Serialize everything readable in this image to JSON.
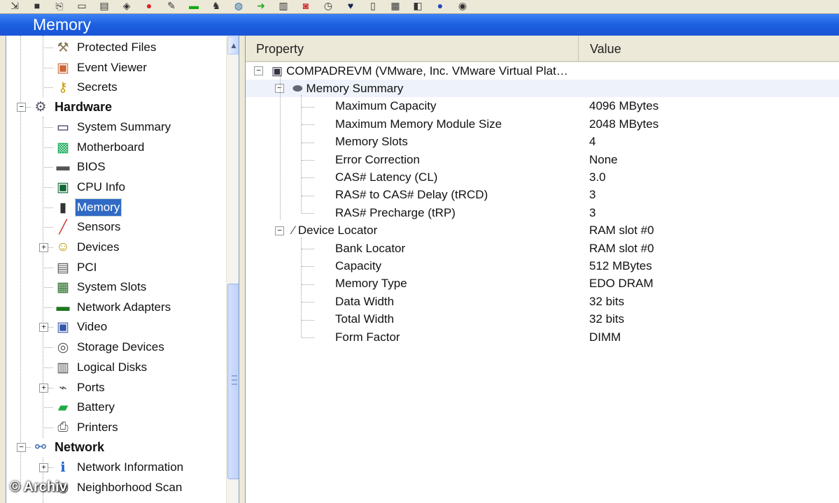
{
  "window": {
    "title": "Memory"
  },
  "toolbar": {
    "icons": [
      "export-icon",
      "save-icon",
      "copy-icon",
      "clipboard-icon",
      "print-icon",
      "scan-icon",
      "close-icon",
      "chat-icon",
      "green-icon",
      "wolf-icon",
      "globe-icon",
      "arrow-icon",
      "report-icon",
      "camera-icon",
      "clock-icon",
      "shield-icon",
      "books-icon",
      "chip-icon",
      "window-icon",
      "info-icon",
      "eye-icon"
    ]
  },
  "tree": {
    "items": [
      {
        "label": "Protected Files",
        "icon": "tools-icon"
      },
      {
        "label": "Event Viewer",
        "icon": "event-icon"
      },
      {
        "label": "Secrets",
        "icon": "key-icon"
      },
      {
        "label": "Hardware",
        "icon": "hardware-icon"
      },
      {
        "label": "System Summary",
        "icon": "monitor-icon"
      },
      {
        "label": "Motherboard",
        "icon": "motherboard-icon"
      },
      {
        "label": "BIOS",
        "icon": "bios-chip-icon"
      },
      {
        "label": "CPU Info",
        "icon": "cpu-icon"
      },
      {
        "label": "Memory",
        "icon": "memory-icon"
      },
      {
        "label": "Sensors",
        "icon": "thermometer-icon"
      },
      {
        "label": "Devices",
        "icon": "devices-icon"
      },
      {
        "label": "PCI",
        "icon": "pci-icon"
      },
      {
        "label": "System Slots",
        "icon": "slots-icon"
      },
      {
        "label": "Network Adapters",
        "icon": "nic-icon"
      },
      {
        "label": "Video",
        "icon": "video-icon"
      },
      {
        "label": "Storage Devices",
        "icon": "storage-icon"
      },
      {
        "label": "Logical Disks",
        "icon": "disk-icon"
      },
      {
        "label": "Ports",
        "icon": "ports-icon"
      },
      {
        "label": "Battery",
        "icon": "battery-icon"
      },
      {
        "label": "Printers",
        "icon": "printer-icon"
      },
      {
        "label": "Network",
        "icon": "network-icon"
      },
      {
        "label": "Network Information",
        "icon": "info-icon"
      },
      {
        "label": "Neighborhood Scan",
        "icon": "scan-icon"
      }
    ]
  },
  "list": {
    "columns": {
      "property": "Property",
      "value": "Value"
    },
    "root": "COMPADREVM (VMware, Inc. VMware Virtual Plat…",
    "groups": [
      {
        "label": "Memory Summary",
        "value": "",
        "rows": [
          {
            "p": "Maximum Capacity",
            "v": "4096 MBytes"
          },
          {
            "p": "Maximum Memory Module Size",
            "v": "2048 MBytes"
          },
          {
            "p": "Memory Slots",
            "v": "4"
          },
          {
            "p": "Error Correction",
            "v": "None"
          },
          {
            "p": "CAS# Latency (CL)",
            "v": "3.0"
          },
          {
            "p": "RAS# to CAS# Delay (tRCD)",
            "v": "3"
          },
          {
            "p": "RAS# Precharge (tRP)",
            "v": "3"
          }
        ]
      },
      {
        "label": "Device Locator",
        "value": "RAM slot #0",
        "rows": [
          {
            "p": "Bank Locator",
            "v": "RAM slot #0"
          },
          {
            "p": "Capacity",
            "v": "512 MBytes"
          },
          {
            "p": "Memory Type",
            "v": "EDO DRAM"
          },
          {
            "p": "Data Width",
            "v": "32 bits"
          },
          {
            "p": "Total Width",
            "v": "32 bits"
          },
          {
            "p": "Form Factor",
            "v": "DIMM"
          }
        ]
      }
    ]
  },
  "watermark": "© Archiv"
}
